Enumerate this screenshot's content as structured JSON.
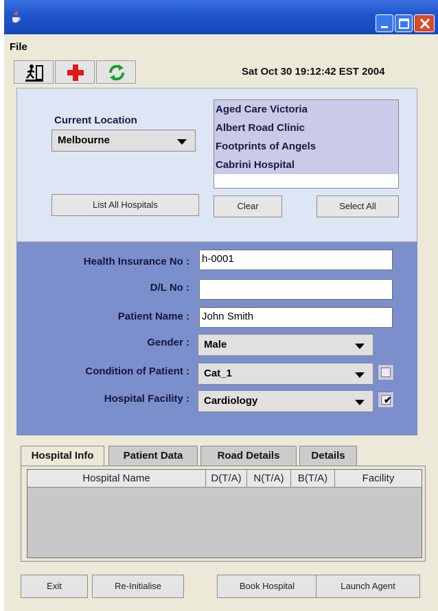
{
  "window": {
    "title": ""
  },
  "menu": {
    "file": "File"
  },
  "toolbar": {
    "buttons": [
      "exit-person-icon",
      "red-cross-icon",
      "refresh-icon"
    ],
    "datetime": "Sat Oct 30 19:12:42 EST 2004"
  },
  "location": {
    "current_label": "Current Location",
    "current_value": "Melbourne",
    "hospitals": [
      "Aged Care Victoria",
      "Albert Road Clinic",
      "Footprints of Angels",
      "Cabrini Hospital"
    ],
    "list_all_button": "List All Hospitals",
    "clear_button": "Clear",
    "select_all_button": "Select All"
  },
  "patient": {
    "health_insurance_label": "Health Insurance No :",
    "health_insurance_value": "h-0001",
    "dl_label": "D/L No :",
    "dl_value": "",
    "name_label": "Patient Name :",
    "name_value": "John Smith",
    "gender_label": "Gender :",
    "gender_value": "Male",
    "condition_label": "Condition of Patient :",
    "condition_value": "Cat_1",
    "condition_checked": false,
    "facility_label": "Hospital Facility :",
    "facility_value": "Cardiology",
    "facility_checked": true
  },
  "tabs": {
    "items": [
      "Hospital Info",
      "Patient Data",
      "Road Details",
      "Details"
    ],
    "active": "Hospital Info"
  },
  "table": {
    "columns": [
      "Hospital Name",
      "D(T/A)",
      "N(T/A)",
      "B(T/A)",
      "Facility"
    ],
    "rows": []
  },
  "footer": {
    "exit": "Exit",
    "reinitialise": "Re-Initialise",
    "book": "Book Hospital",
    "launch": "Launch Agent"
  },
  "colors": {
    "titlebar": "#1f55cc",
    "location_panel": "#dde6f4",
    "patient_panel": "#7b8fcc",
    "list_selection": "#c9cbe9"
  }
}
